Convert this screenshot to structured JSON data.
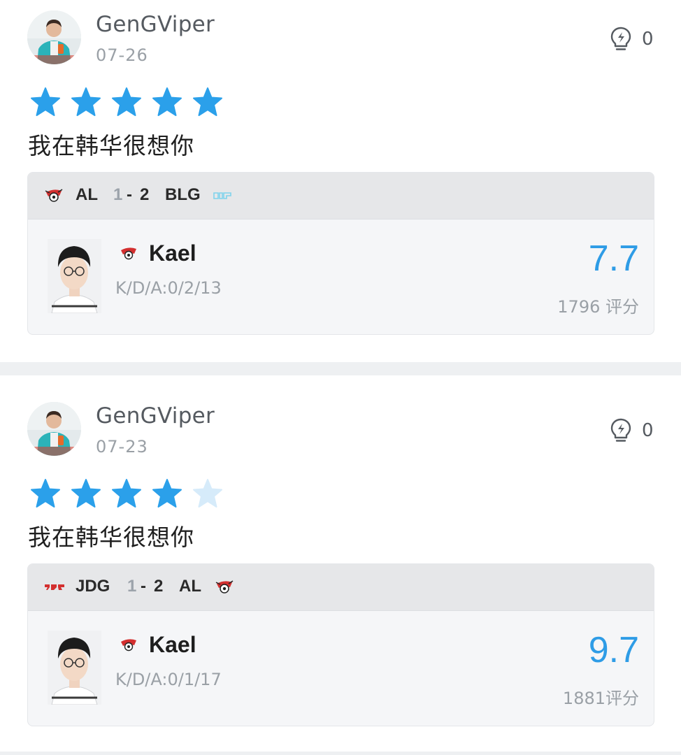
{
  "posts": [
    {
      "username": "GenGViper",
      "date": "07-26",
      "likes": "0",
      "rating_stars": 5,
      "comment": "我在韩华很想你",
      "match": {
        "team_left": "AL",
        "score_left": "1",
        "score_sep": "-",
        "score_right": "2",
        "team_right": "BLG"
      },
      "player": {
        "name": "Kael",
        "kda": "K/D/A:0/2/13",
        "score": "7.7",
        "votes": "1796 评分"
      }
    },
    {
      "username": "GenGViper",
      "date": "07-23",
      "likes": "0",
      "rating_stars": 4,
      "comment": "我在韩华很想你",
      "match": {
        "team_left": "JDG",
        "score_left": "1",
        "score_sep": "-",
        "score_right": "2",
        "team_right": "AL"
      },
      "player": {
        "name": "Kael",
        "kda": "K/D/A:0/1/17",
        "score": "9.7",
        "votes": "1881评分"
      }
    }
  ],
  "colors": {
    "star_filled": "#2ba0ea",
    "star_empty": "#d6ebfa",
    "score_blue": "#2e9ce6"
  },
  "icons": {
    "like": "lightbulb-icon",
    "star": "star-icon",
    "team_al": "al-team-logo-icon",
    "team_blg": "blg-team-logo-icon",
    "team_jdg": "jdg-team-logo-icon"
  }
}
